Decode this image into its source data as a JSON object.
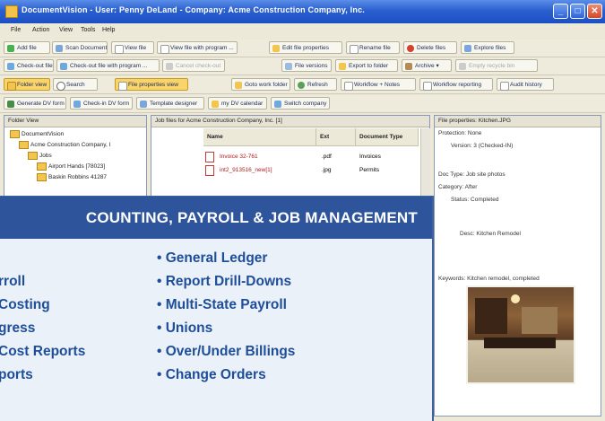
{
  "window": {
    "title": "DocumentVision - User: Penny DeLand - Company: Acme Construction Company, Inc."
  },
  "menu": [
    "File",
    "Action",
    "View",
    "Tools",
    "Help"
  ],
  "toolbar1": [
    "Add file",
    "Scan Document",
    "View file",
    "View file with program ...",
    "Edit file properties",
    "Rename file",
    "Delete files",
    "Explore files"
  ],
  "toolbar2": [
    "Check-out file",
    "Check-out file with program ...",
    "Cancel check-out",
    "File versions",
    "Export to folder",
    "Archive",
    "Empty recycle bin"
  ],
  "toolbar3": [
    "Folder view",
    "Search",
    "File properties view",
    "Goto work folder",
    "Refresh",
    "Workflow + Notes",
    "Workflow reporting",
    "Audit history"
  ],
  "toolbar4": [
    "Generate DV form",
    "Check-in DV form",
    "Template designer",
    "my DV calendar",
    "Switch company"
  ],
  "folder_pane": {
    "header": "Folder View",
    "items": [
      "DocumentVision",
      "Acme Construction Company, I",
      "Jobs",
      "Airport Hands [78023]",
      "Baskin Robbins 41287"
    ]
  },
  "files_pane": {
    "header": "Job files for Acme Construction Company, Inc. [1]",
    "columns": [
      "Name",
      "Ext",
      "Document Type"
    ],
    "rows": [
      {
        "name": "Invoice 32-761",
        "ext": ".pdf",
        "type": "Invoices"
      },
      {
        "name": "int2_913516_new[1]",
        "ext": ".jpg",
        "type": "Permits"
      }
    ]
  },
  "properties_pane": {
    "header": "File properties: Kitchen.JPG",
    "fields": [
      "Protection: None",
      "Version: 3 (Checked-IN)",
      "Doc Type: Job site photos",
      "Category: After",
      "Status: Completed",
      "Desc: Kitchen Remodel",
      "Keywords: Kitchen remodel, completed"
    ]
  },
  "overlay": {
    "heading": "COUNTING, PAYROLL & JOB MANAGEMENT",
    "left_features": [
      "rroll",
      "Costing",
      "gress",
      "Cost Reports",
      "ports"
    ],
    "right_features": [
      "• General Ledger",
      "• Report Drill-Downs",
      "• Multi-State Payroll",
      "• Unions",
      "• Over/Under Billings",
      "• Change Orders"
    ]
  }
}
